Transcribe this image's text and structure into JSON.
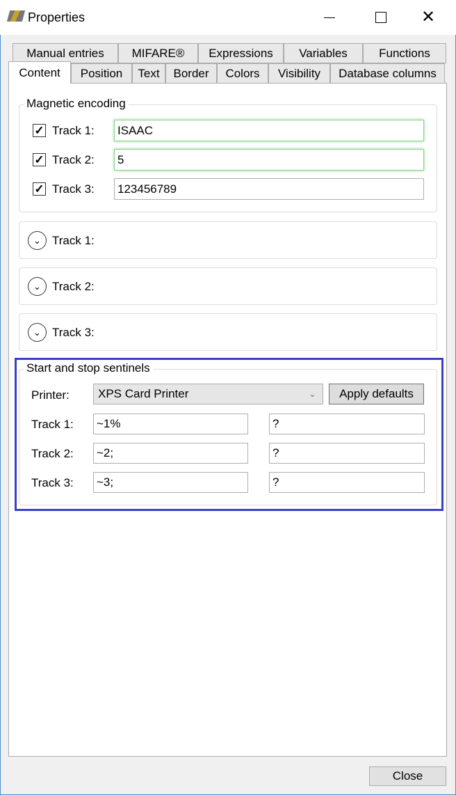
{
  "window": {
    "title": "Properties",
    "minimize_icon": "minimize-icon",
    "maximize_icon": "maximize-icon",
    "close_icon": "close-icon"
  },
  "tabs_row1": [
    "Manual entries",
    "MIFARE®",
    "Expressions",
    "Variables",
    "Functions"
  ],
  "tabs_row2": [
    "Content",
    "Position",
    "Text",
    "Border",
    "Colors",
    "Visibility",
    "Database columns"
  ],
  "selected_tab": "Content",
  "magnetic": {
    "title": "Magnetic encoding",
    "tracks": [
      {
        "label": "Track 1:",
        "checked": true,
        "value": "ISAAC"
      },
      {
        "label": "Track 2:",
        "checked": true,
        "value": "5"
      },
      {
        "label": "Track 3:",
        "checked": true,
        "value": "123456789"
      }
    ]
  },
  "expanders": [
    "Track 1:",
    "Track 2:",
    "Track 3:"
  ],
  "sentinels": {
    "title": "Start and stop sentinels",
    "printer_label": "Printer:",
    "printer_value": "XPS Card Printer",
    "apply_label": "Apply defaults",
    "highlight_color": "#3b3fc4",
    "tracks": [
      {
        "label": "Track 1:",
        "start": "~1%",
        "stop": "?"
      },
      {
        "label": "Track 2:",
        "start": "~2;",
        "stop": "?"
      },
      {
        "label": "Track 3:",
        "start": "~3;",
        "stop": "?"
      }
    ]
  },
  "footer": {
    "close_label": "Close"
  }
}
